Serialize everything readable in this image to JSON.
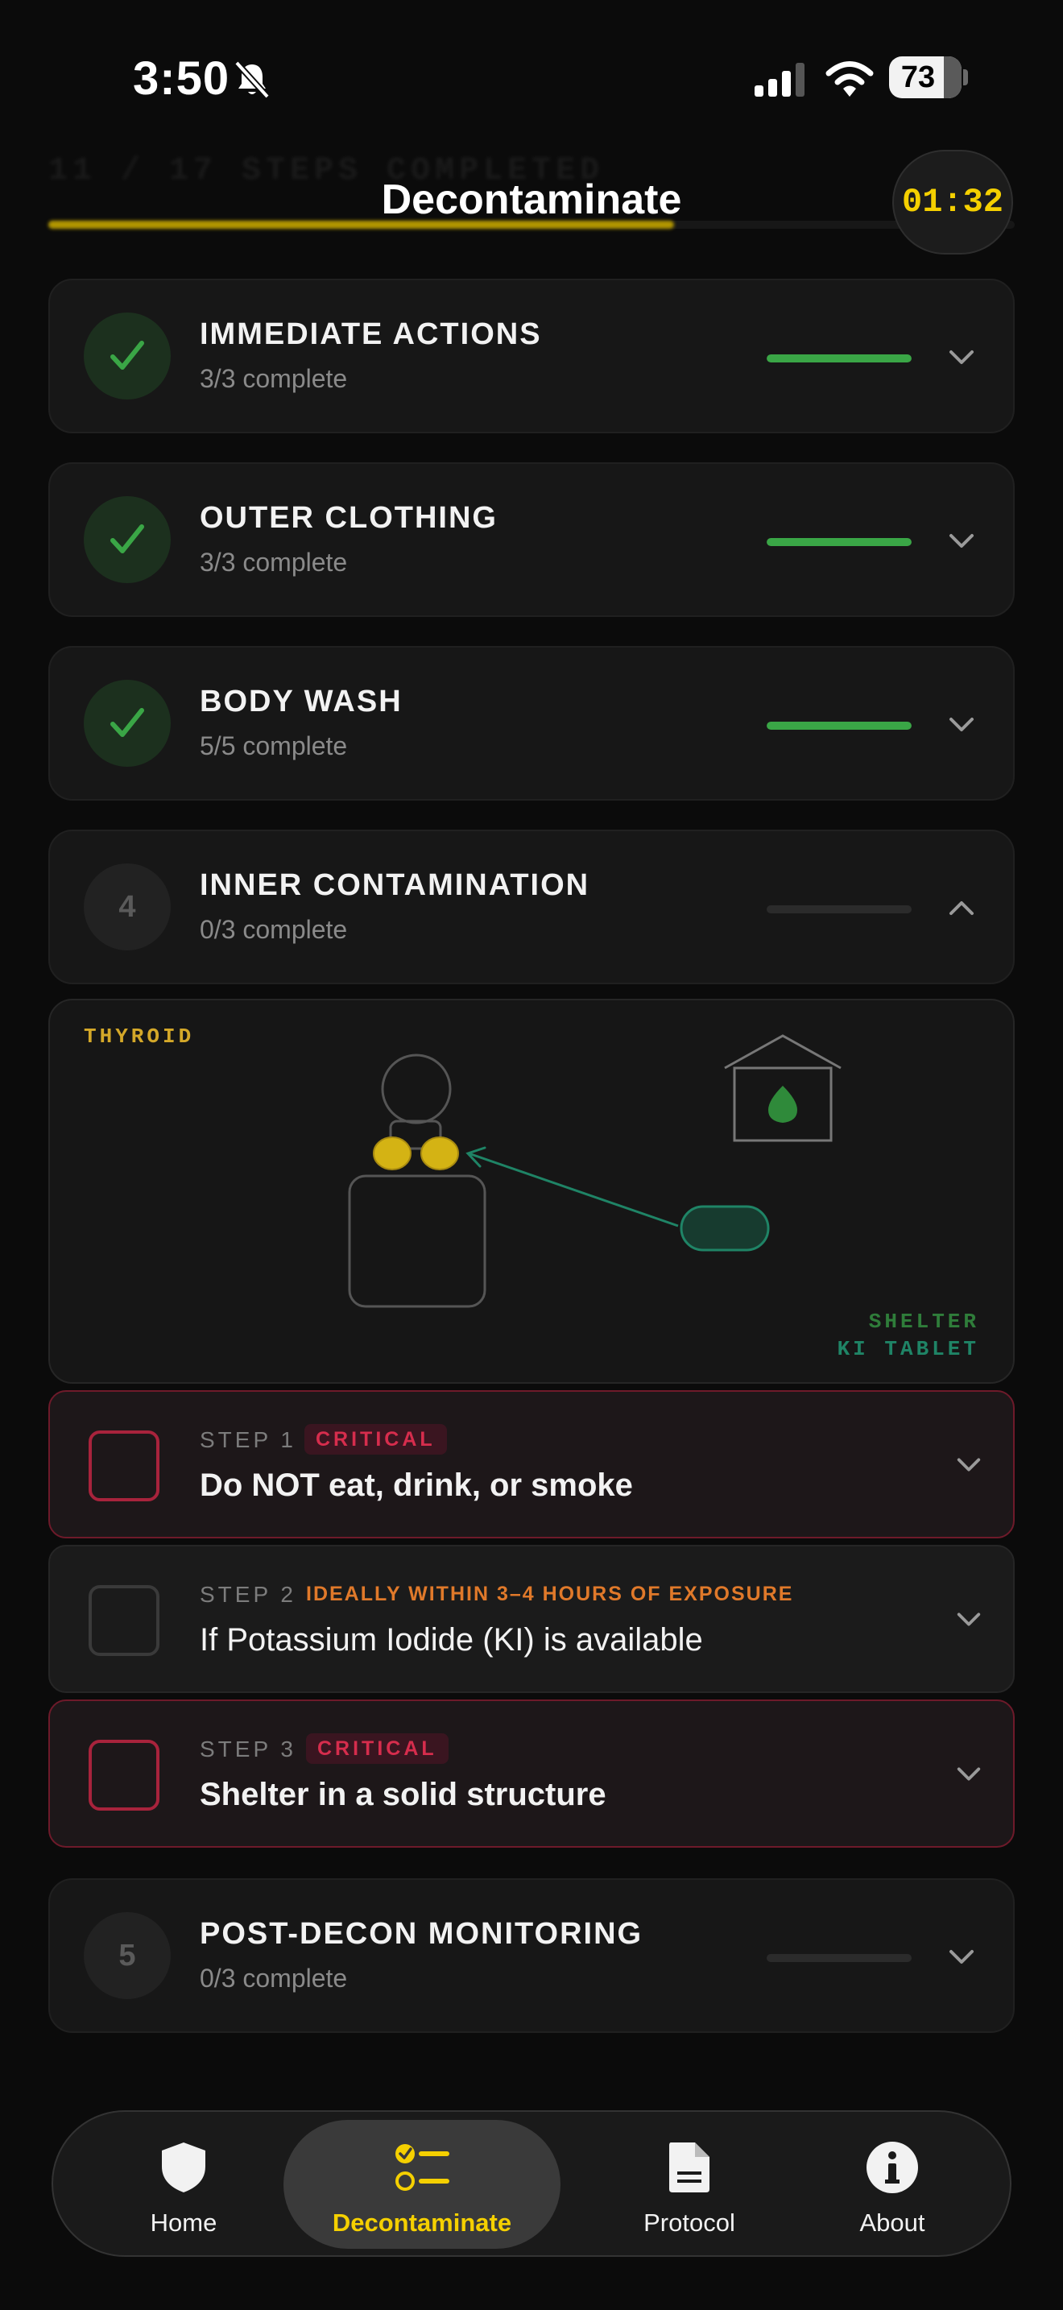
{
  "status_bar": {
    "time": "3:50",
    "battery_pct": "73",
    "icons": [
      "bell-slash-icon",
      "cellular-signal-icon",
      "wifi-icon",
      "battery-icon"
    ]
  },
  "header": {
    "progress_text": "11 / 17 STEPS COMPLETED",
    "progress_fraction": 0.6471,
    "title": "Decontaminate",
    "timer": "01:32"
  },
  "colors": {
    "accent_yellow": "#f5d000",
    "complete_green": "#3aa646",
    "critical_red": "#d62d4d",
    "note_orange": "#e0792a",
    "ki_teal": "#1f8466"
  },
  "sections": [
    {
      "title": "IMMEDIATE ACTIONS",
      "subtitle": "3/3 complete",
      "done": 3,
      "total": 3,
      "status": "complete",
      "expanded": false
    },
    {
      "title": "OUTER CLOTHING",
      "subtitle": "3/3 complete",
      "done": 3,
      "total": 3,
      "status": "complete",
      "expanded": false
    },
    {
      "title": "BODY WASH",
      "subtitle": "5/5 complete",
      "done": 5,
      "total": 5,
      "status": "complete",
      "expanded": false
    },
    {
      "number": "4",
      "title": "INNER CONTAMINATION",
      "subtitle": "0/3 complete",
      "done": 0,
      "total": 3,
      "status": "pending",
      "expanded": true
    },
    {
      "number": "5",
      "title": "POST-DECON MONITORING",
      "subtitle": "0/3 complete",
      "done": 0,
      "total": 3,
      "status": "pending",
      "expanded": false
    }
  ],
  "illustration": {
    "thyroid_label": "THYROID",
    "shelter_label": "SHELTER",
    "ki_label": "KI TABLET"
  },
  "steps": [
    {
      "label": "STEP 1",
      "tag": "CRITICAL",
      "tag_type": "critical",
      "text": "Do NOT eat, drink, or smoke",
      "checked": false
    },
    {
      "label": "STEP 2",
      "tag": "IDEALLY WITHIN 3–4 HOURS OF EXPOSURE",
      "tag_type": "note",
      "text": "If Potassium Iodide (KI) is available",
      "checked": false
    },
    {
      "label": "STEP 3",
      "tag": "CRITICAL",
      "tag_type": "critical",
      "text": "Shelter in a solid structure",
      "checked": false
    }
  ],
  "tabbar": {
    "home": "Home",
    "decontaminate": "Decontaminate",
    "protocol": "Protocol",
    "about": "About",
    "active": "decontaminate"
  }
}
